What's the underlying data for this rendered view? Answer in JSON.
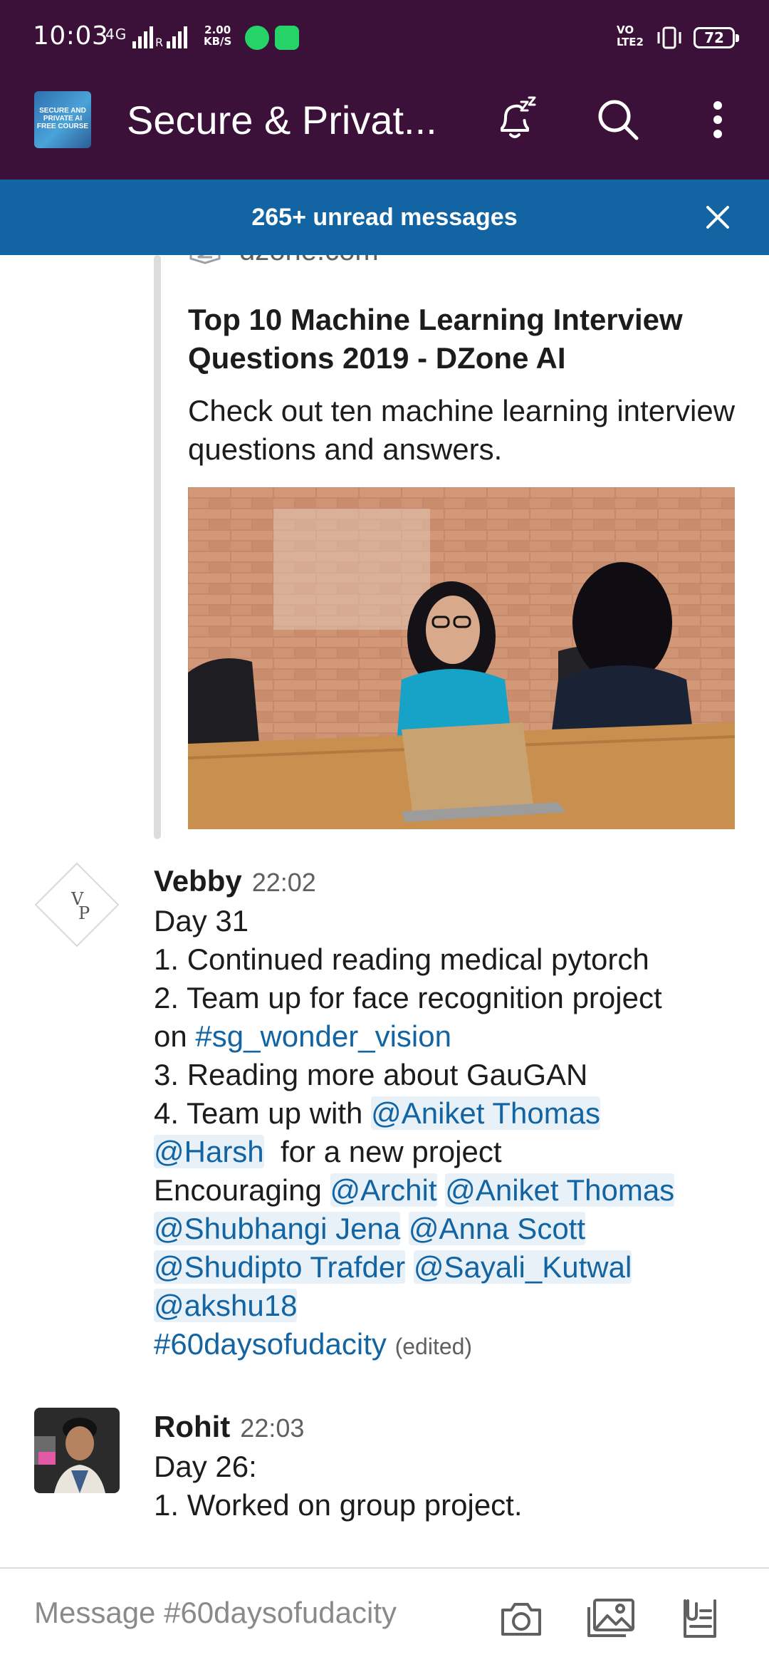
{
  "status_bar": {
    "time": "10:03",
    "network": "4G",
    "roaming": "R",
    "speed_value": "2.00",
    "speed_unit": "KB/S",
    "volte": "VO LTE2",
    "battery": "72",
    "icons": [
      "whatsapp-icon",
      "whatsapp-business-icon",
      "vibrate-icon"
    ]
  },
  "header": {
    "channel_title": "Secure & Privat...",
    "avatar_text": "SECURE AND PRIVATE AI FREE COURSE",
    "icons": [
      "snooze-bell-icon",
      "search-icon",
      "more-vertical-icon"
    ]
  },
  "banner": {
    "text": "265+ unread messages",
    "color": "#1264a3"
  },
  "link_preview": {
    "source": "dzone.com",
    "title": "Top 10 Machine Learning Interview Questions 2019 - DZone AI",
    "description": "Check out ten machine learning interview questions and answers."
  },
  "messages": [
    {
      "name": "Vebby",
      "time": "22:02",
      "avatar_letters": [
        "V",
        "P"
      ],
      "lines": {
        "l1": "Day 31",
        "l2": "1. Continued reading medical pytorch",
        "l3": "2. Team up for face recognition  project",
        "l4_pre": "on ",
        "l4_channel": "#sg_wonder_vision",
        "l5": "3. Reading more about GauGAN",
        "l6_pre": "4. Team up with ",
        "m_aniket": "@Aniket Thomas",
        "m_harsh": "@Harsh",
        "l7_post": "  for a new project",
        "l8_pre": "Encouraging ",
        "m_archit": "@Archit",
        "m_aniket2": "@Aniket Thomas",
        "m_shubhangi": "@Shubhangi Jena",
        "m_anna": "@Anna Scott",
        "m_shudipto": "@Shudipto Trafder",
        "m_sayali": "@Sayali_Kutwal",
        "m_akshu": "@akshu18",
        "hashtag": "#60daysofudacity",
        "edited": "(edited)"
      }
    },
    {
      "name": "Rohit",
      "time": "22:03",
      "lines": [
        "Day 26:",
        "1. Worked on group project."
      ]
    }
  ],
  "composer": {
    "placeholder": "Message #60daysofudacity",
    "icons": [
      "camera-icon",
      "gallery-icon",
      "files-icon"
    ]
  },
  "colors": {
    "header_bg": "#3b1039",
    "link": "#1264a3",
    "mention_bg": "#e8f1f8"
  }
}
